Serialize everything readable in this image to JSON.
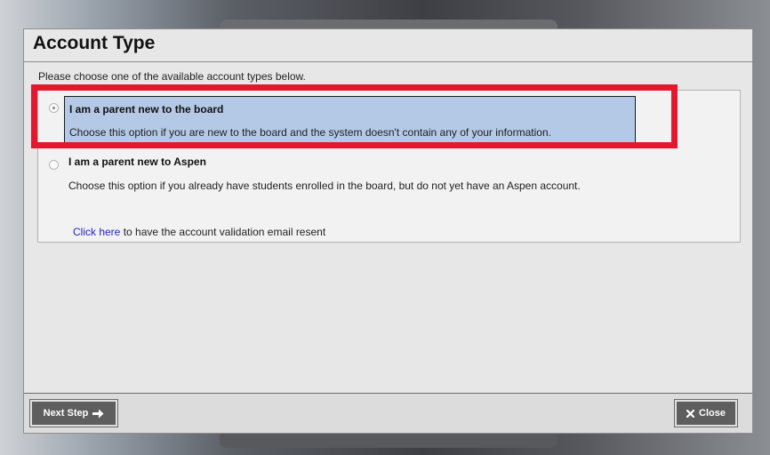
{
  "dialog": {
    "title": "Account Type",
    "instructions": "Please choose one of the available account types below.",
    "options": [
      {
        "title": "I am a parent new to the board",
        "description": "Choose this option if you are new to the board and the system doesn't contain any of your information.",
        "selected": true
      },
      {
        "title": "I am a parent new to Aspen",
        "description": "Choose this option if you already have students enrolled in the board, but do not yet have an Aspen account.",
        "selected": false
      }
    ],
    "resend": {
      "link_text": "Click here",
      "rest_text": " to have the account validation email resent"
    },
    "footer": {
      "next_label": "Next Step",
      "close_label": "Close"
    }
  },
  "colors": {
    "highlight": "#e5172c",
    "selected_option_bg": "#b3c9e6",
    "link": "#2323c7",
    "button_bg": "#5e5e5e"
  },
  "icons": {
    "next": "arrow-right-icon",
    "close": "x-icon"
  }
}
